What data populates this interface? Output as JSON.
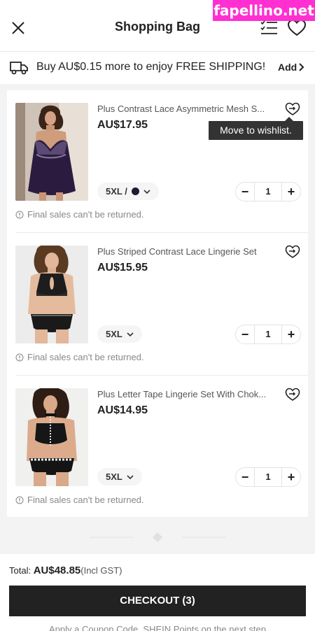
{
  "watermark": "fapellino.net",
  "header": {
    "title": "Shopping Bag"
  },
  "shipping": {
    "text": "Buy AU$0.15 more to enjoy FREE SHIPPING!",
    "add_label": "Add"
  },
  "tooltip": "Move to wishlist.",
  "items": [
    {
      "name": "Plus Contrast Lace Asymmetric Mesh S...",
      "price": "AU$17.95",
      "size": "5XL /",
      "color_swatch": "#1c1c36",
      "qty": "1",
      "notice": "Final sales can't be returned."
    },
    {
      "name": "Plus Striped Contrast Lace Lingerie Set",
      "price": "AU$15.95",
      "size": "5XL",
      "qty": "1",
      "notice": "Final sales can't be returned."
    },
    {
      "name": "Plus Letter Tape Lingerie Set With Chok...",
      "price": "AU$14.95",
      "size": "5XL",
      "qty": "1",
      "notice": "Final sales can't be returned."
    }
  ],
  "footer": {
    "total_label": "Total:",
    "total_value": "AU$48.85",
    "total_note": "(Incl GST)",
    "checkout_label": "CHECKOUT (3)",
    "note": "Apply a Coupon Code, SHEIN Points on the next step"
  },
  "colors": {
    "watermark_bg": "#ff2fd1",
    "checkout_bg": "#222222",
    "text": "#222222"
  }
}
